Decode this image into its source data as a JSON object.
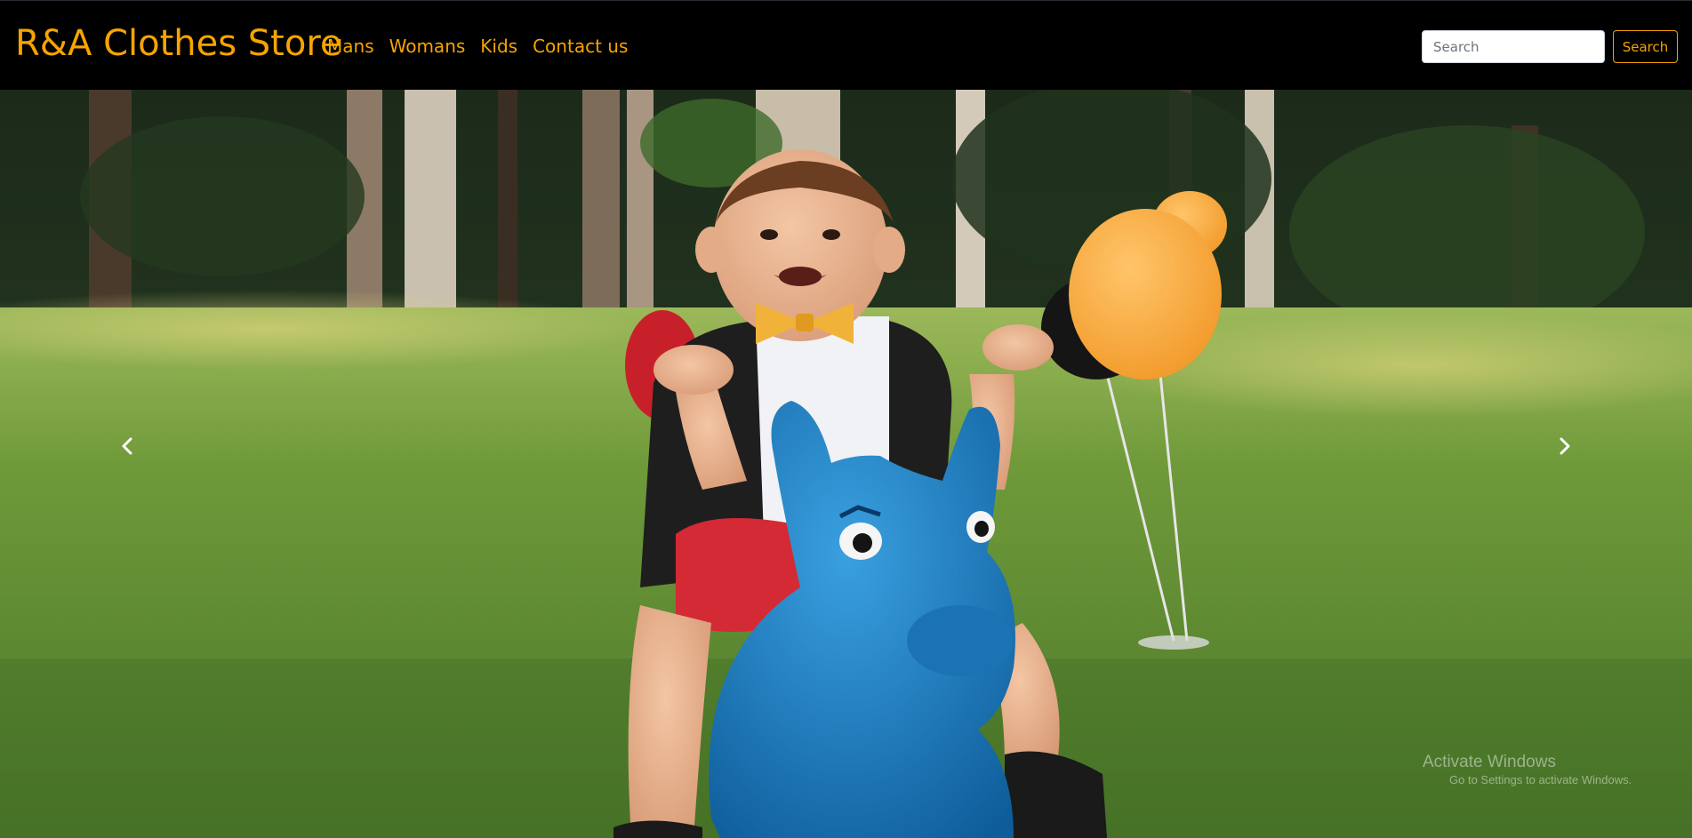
{
  "brand": {
    "name": "R&A Clothes Store"
  },
  "nav": {
    "items": [
      {
        "label": "Mans"
      },
      {
        "label": "Womans"
      },
      {
        "label": "Kids"
      },
      {
        "label": "Contact us"
      }
    ]
  },
  "search": {
    "placeholder": "Search",
    "value": "",
    "button_label": "Search"
  },
  "carousel": {
    "prev_icon": "chevron-left-icon",
    "next_icon": "chevron-right-icon"
  },
  "watermark": {
    "title": "Activate Windows",
    "subtitle": "Go to Settings to activate Windows."
  },
  "colors": {
    "accent": "#f7a400",
    "navbar_bg": "#000000"
  }
}
